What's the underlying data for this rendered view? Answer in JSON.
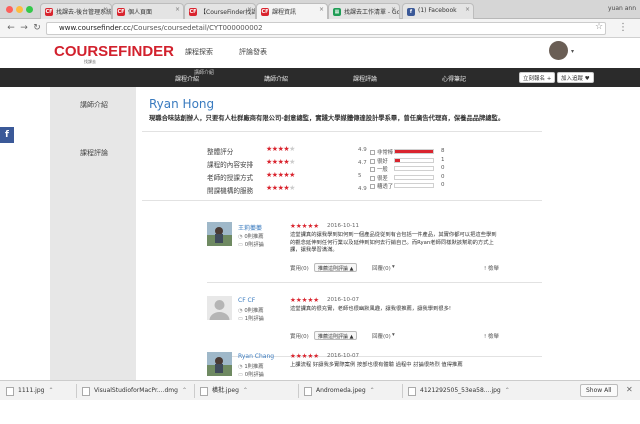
{
  "browser": {
    "user": "yuan ann",
    "tabs": [
      {
        "label": "找課去-後台管理系統",
        "fav": "CF",
        "fav_color": "#d9242e"
      },
      {
        "label": "個人頁面",
        "fav": "CF",
        "fav_color": "#d9242e"
      },
      {
        "label": "【CourseFinder找課去",
        "fav": "CF",
        "fav_color": "#d9242e"
      },
      {
        "label": "課程資訊",
        "fav": "CF",
        "fav_color": "#d9242e"
      },
      {
        "label": "找課去工作清單 - Goo",
        "fav": "▦",
        "fav_color": "#1f9d55"
      },
      {
        "label": "(1) Facebook",
        "fav": "f",
        "fav_color": "#3b5998"
      }
    ],
    "url_host": "www.coursefinder.cc",
    "url_path": "/Courses/coursedetail/CYT000000002"
  },
  "site": {
    "logo": "COURSEFINDER",
    "logo_sub": "找課去",
    "nav": [
      "課程探索",
      "評論發表"
    ]
  },
  "subnav": {
    "items": [
      "課程介紹",
      "講師介紹",
      "課程評論",
      "心得筆記"
    ],
    "small_label": "講師介紹",
    "btn_follow": "立刻報名",
    "btn_follow_icon": "+",
    "btn_like": "加入追蹤",
    "btn_like_icon": "♥"
  },
  "sidebar": {
    "instructor_label": "講師介紹",
    "reviews_label": "課程評論"
  },
  "teacher": {
    "name": "Ryan Hong",
    "desc": "現職合味誌創辦人，只要有人杜群廠商有限公司-創意總監，實踐大學媒體傳達設計學系畢，曾任廣告代理商，保養品品牌總監。"
  },
  "ratings": {
    "rows": [
      {
        "label": "整體評分",
        "score": "4.9",
        "stars": 4
      },
      {
        "label": "課程的內容安排",
        "score": "4.7",
        "stars": 4
      },
      {
        "label": "老師的授課方式",
        "score": "5",
        "stars": 5
      },
      {
        "label": "開課機構的服務",
        "score": "4.9",
        "stars": 4
      }
    ],
    "distribution": [
      {
        "label": "非常棒",
        "count": "8",
        "fraction": 1.0
      },
      {
        "label": "很好",
        "count": "1",
        "fraction": 0.12
      },
      {
        "label": "一般",
        "count": "0",
        "fraction": 0
      },
      {
        "label": "很差",
        "count": "0",
        "fraction": 0
      },
      {
        "label": "糟透了",
        "count": "0",
        "fraction": 0
      }
    ],
    "star_color": "#d9242e"
  },
  "reviews": [
    {
      "user": "王莉蓁蓁",
      "likes": "0則推薦",
      "comments": "0則評論",
      "date": "2016-10-11",
      "text": "這堂課真的讓我學到如何到一個產品從從到有合包括一件產品，其實你都可以把這些學到的觀念延伸到任何行業以及延伸到如何去行銷自己。而Ryan老師同樣默該幫助的方式上課，讓我學習滿滿。",
      "useful": "實用(0)",
      "push_btn": "推薦這則評論",
      "reply": "回覆(0)",
      "report": "檢舉",
      "avatar": "photo"
    },
    {
      "user": "CF CF",
      "likes": "0則推薦",
      "comments": "1則評論",
      "date": "2016-10-07",
      "text": "這堂課真的很充實，老師也很幽默風趣，讓我很推薦，讓我學到很多!",
      "useful": "實用(0)",
      "push_btn": "推薦這則評論",
      "reply": "回覆(0)",
      "report": "檢舉",
      "avatar": "default"
    },
    {
      "user": "Ryan Chang",
      "likes": "1則推薦",
      "comments": "0則評論",
      "date": "2016-10-07",
      "text": "上課流程 好讓我多實際案例 按部也很有體驗 過程中 討論很熱烈 值得推薦",
      "useful": "",
      "push_btn": "",
      "reply": "",
      "report": "",
      "avatar": "photo"
    }
  ],
  "downloads": {
    "items": [
      "1111.jpg",
      "VisualStudioforMacPr....dmg",
      "橫批.jpeg",
      "Andromeda.jpeg",
      "41212925​05_53ea58....jpg"
    ],
    "show_all": "Show All",
    "close": "✕"
  }
}
